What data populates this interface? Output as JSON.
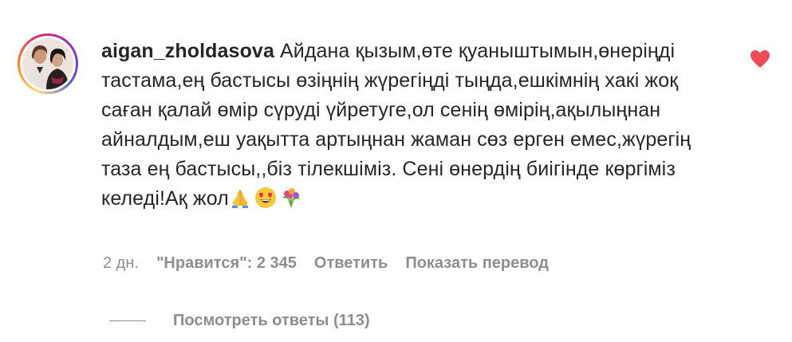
{
  "comment": {
    "username": "aigan_zholdasova",
    "text": "Айдана қызым,өте қуаныштымын,өнеріңді тастама,ең бастысы өзіңнің жүрегіңді тыңда,ешкімнің хакі жоқ саған қалай өмір сүруді үйретуге,ол сенің өмірің,ақылыңнан айналдым,еш уақытта артыңнан жаман сөз ерген емес,жүрегің таза ең бастысы,,біз тілекшіміз. Сені өнердің биігінде көргіміз келеді!Ақ жол",
    "emojis": [
      "folded-hands",
      "heart-eyes-face",
      "bouquet"
    ],
    "liked": true,
    "heart_color": "#ed4956"
  },
  "meta": {
    "time": "2 дн.",
    "likes": "\"Нравится\": 2 345",
    "reply": "Ответить",
    "translate": "Показать перевод"
  },
  "replies": {
    "label": "Посмотреть ответы (113)"
  }
}
